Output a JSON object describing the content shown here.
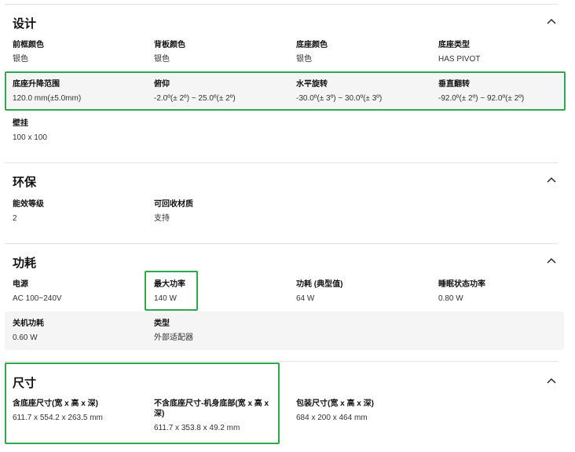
{
  "sections": {
    "design": {
      "title": "设计",
      "specs": [
        {
          "label": "前框颜色",
          "value": "银色"
        },
        {
          "label": "背板颜色",
          "value": "银色"
        },
        {
          "label": "底座颜色",
          "value": "银色"
        },
        {
          "label": "底座类型",
          "value": "HAS PIVOT"
        },
        {
          "label": "底座升降范围",
          "value": "120.0 mm(±5.0mm)"
        },
        {
          "label": "俯仰",
          "value": "-2.0º(± 2º) ~ 25.0º(± 2º)"
        },
        {
          "label": "水平旋转",
          "value": "-30.0º(± 3º) ~ 30.0º(± 3º)"
        },
        {
          "label": "垂直翻转",
          "value": "-92.0º(± 2º) ~ 92.0º(± 2º)"
        },
        {
          "label": "壁挂",
          "value": "100 x 100"
        }
      ]
    },
    "eco": {
      "title": "环保",
      "specs": [
        {
          "label": "能效等级",
          "value": "2"
        },
        {
          "label": "可回收材质",
          "value": "支持"
        }
      ]
    },
    "power": {
      "title": "功耗",
      "specs": [
        {
          "label": "电源",
          "value": "AC 100~240V"
        },
        {
          "label": "最大功率",
          "value": "140 W"
        },
        {
          "label": "功耗 (典型值)",
          "value": "64 W"
        },
        {
          "label": "睡眠状态功率",
          "value": "0.80 W"
        },
        {
          "label": "关机功耗",
          "value": "0.60 W"
        },
        {
          "label": "类型",
          "value": "外部适配器"
        }
      ]
    },
    "dimensions": {
      "title": "尺寸",
      "specs": [
        {
          "label": "含底座尺寸(宽 x 高 x 深)",
          "value": "611.7 x 554.2 x 263.5 mm"
        },
        {
          "label_line1": "不含底座尺寸-机身底部(宽 x 高 x",
          "label_line2": "深)",
          "value": "611.7 x 353.8 x 49.2 mm"
        },
        {
          "label": "包装尺寸(宽 x 高 x 深)",
          "value": "684 x 200 x 464 mm"
        }
      ]
    }
  },
  "colors": {
    "highlight": "#2ea84a",
    "divider": "#e2e2e2",
    "shaded_row": "#f5f5f5"
  },
  "icons": {
    "collapse": "chevron-up-icon"
  }
}
